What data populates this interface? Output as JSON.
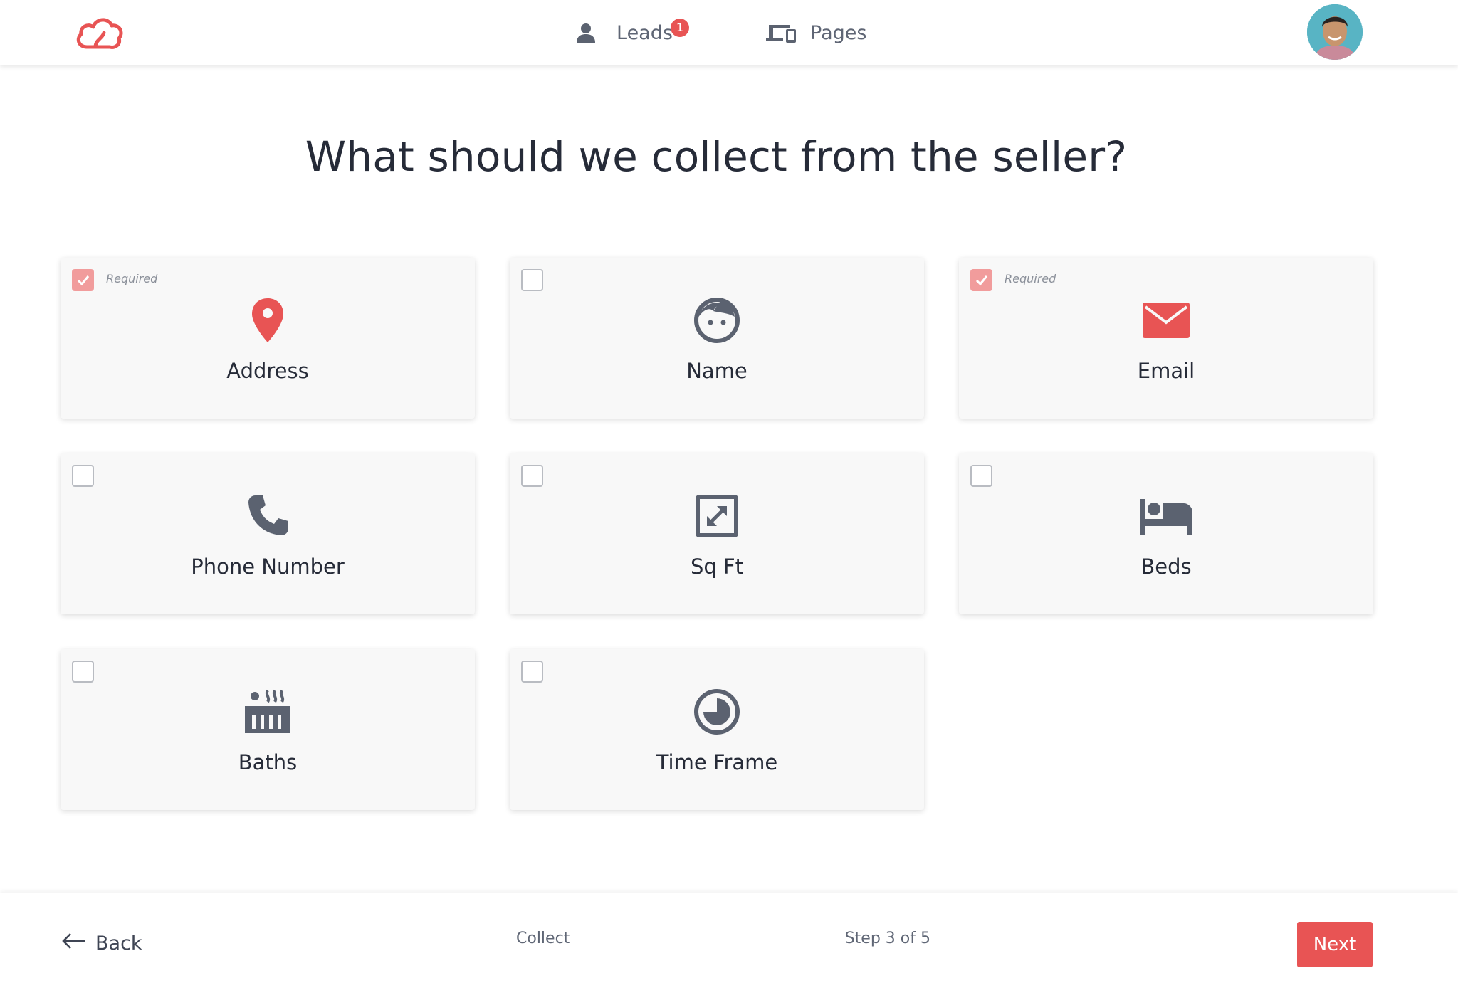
{
  "nav": {
    "leads_label": "Leads",
    "leads_badge": "1",
    "pages_label": "Pages"
  },
  "page": {
    "title": "What should we collect from the seller?"
  },
  "options": [
    {
      "label": "Address",
      "checked": true,
      "required_text": "Required",
      "icon": "map-pin-icon"
    },
    {
      "label": "Name",
      "checked": false,
      "icon": "face-icon"
    },
    {
      "label": "Email",
      "checked": true,
      "required_text": "Required",
      "icon": "envelope-icon"
    },
    {
      "label": "Phone Number",
      "checked": false,
      "icon": "phone-icon"
    },
    {
      "label": "Sq Ft",
      "checked": false,
      "icon": "expand-icon"
    },
    {
      "label": "Beds",
      "checked": false,
      "icon": "bed-icon"
    },
    {
      "label": "Baths",
      "checked": false,
      "icon": "bath-icon"
    },
    {
      "label": "Time Frame",
      "checked": false,
      "icon": "clock-icon"
    }
  ],
  "footer": {
    "back_label": "Back",
    "step_name": "Collect",
    "step_count": "Step 3 of 5",
    "progress_fraction": 0.6,
    "next_label": "Next"
  },
  "colors": {
    "accent": "#e85454",
    "checkbox_checked": "#f19c9c",
    "icon_gray": "#5b6270"
  }
}
